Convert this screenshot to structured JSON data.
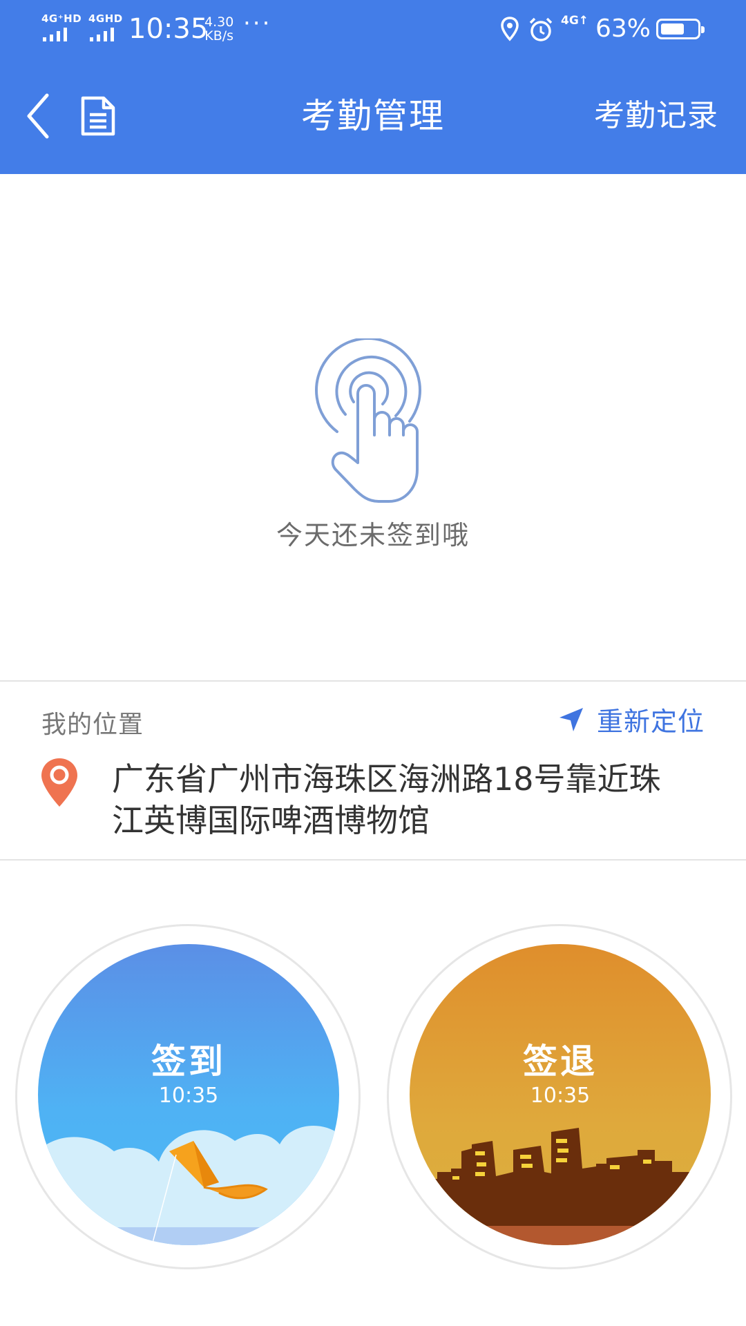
{
  "status_bar": {
    "sim1": "4G⁺HD",
    "sim2": "4GHD",
    "time": "10:35",
    "speed_value": "4.30",
    "speed_unit": "KB/s",
    "dots": "···",
    "data_net": "4G↑",
    "battery_pct": "63%",
    "battery_level": 0.63
  },
  "header": {
    "title": "考勤管理",
    "records_link": "考勤记录"
  },
  "hint": {
    "text": "今天还未签到哦"
  },
  "location": {
    "label": "我的位置",
    "relocate_label": "重新定位",
    "address": "广东省广州市海珠区海洲路18号靠近珠江英博国际啤酒博物馆"
  },
  "actions": {
    "checkin": {
      "label": "签到",
      "time": "10:35"
    },
    "checkout": {
      "label": "签退",
      "time": "10:35"
    }
  },
  "colors": {
    "header_bg": "#437de8",
    "accent_blue": "#3f74e0",
    "pin_orange": "#ef7350",
    "checkin_sky": "#5aa6f0",
    "checkout_sky": "#e0a43a",
    "building_brown": "#6a2e0c"
  }
}
